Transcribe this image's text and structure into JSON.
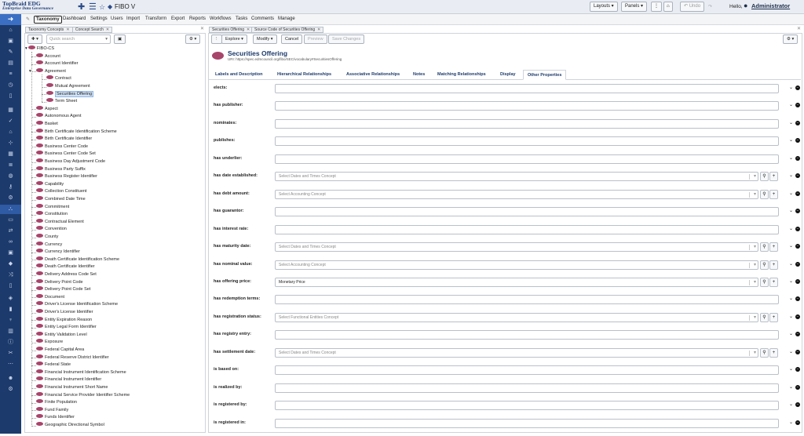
{
  "app": {
    "logo_line1": "TopBraid EDG",
    "logo_line2": "Enterprise Data Governance",
    "title": "FIBO V",
    "undo": "Undo",
    "redo": "",
    "layouts": "Layouts",
    "panels": "Panels",
    "hello": "Hello,",
    "user": "Administrator"
  },
  "menu": [
    "Taxonomy",
    "Dashboard",
    "Settings",
    "Users",
    "Import",
    "Transform",
    "Export",
    "Reports",
    "Workflows",
    "Tasks",
    "Comments",
    "Manage"
  ],
  "left_tabs": [
    "Taxonomy Concepts",
    "Concept Search"
  ],
  "left_toolbar": {
    "search_placeholder": "Quick search"
  },
  "tree": {
    "root": "FIBO-CS",
    "items": [
      {
        "label": "Account",
        "level": 1
      },
      {
        "label": "Account Identifier",
        "level": 1
      },
      {
        "label": "Agreement",
        "level": 1,
        "expanded": true
      },
      {
        "label": "Contract",
        "level": 2
      },
      {
        "label": "Mutual Agreement",
        "level": 2
      },
      {
        "label": "Securities Offering",
        "level": 2,
        "selected": true
      },
      {
        "label": "Term Sheet",
        "level": 2
      },
      {
        "label": "Aspect",
        "level": 1
      },
      {
        "label": "Autonomous Agent",
        "level": 1
      },
      {
        "label": "Basket",
        "level": 1
      },
      {
        "label": "Birth Certificate Identification Scheme",
        "level": 1
      },
      {
        "label": "Birth Certificate Identifier",
        "level": 1
      },
      {
        "label": "Business Center Code",
        "level": 1
      },
      {
        "label": "Business Center Code Set",
        "level": 1
      },
      {
        "label": "Business Day Adjustment Code",
        "level": 1
      },
      {
        "label": "Business Party Suffix",
        "level": 1
      },
      {
        "label": "Business Register Identifier",
        "level": 1
      },
      {
        "label": "Capability",
        "level": 1
      },
      {
        "label": "Collection Constituent",
        "level": 1
      },
      {
        "label": "Combined Date Time",
        "level": 1
      },
      {
        "label": "Commitment",
        "level": 1
      },
      {
        "label": "Constitution",
        "level": 1
      },
      {
        "label": "Contractual Element",
        "level": 1
      },
      {
        "label": "Convention",
        "level": 1
      },
      {
        "label": "County",
        "level": 1
      },
      {
        "label": "Currency",
        "level": 1
      },
      {
        "label": "Currency Identifier",
        "level": 1
      },
      {
        "label": "Death Certificate Identification Scheme",
        "level": 1
      },
      {
        "label": "Death Certificate Identifier",
        "level": 1
      },
      {
        "label": "Delivery Address Code Set",
        "level": 1
      },
      {
        "label": "Delivery Point Code",
        "level": 1
      },
      {
        "label": "Delivery Point Code Set",
        "level": 1
      },
      {
        "label": "Document",
        "level": 1
      },
      {
        "label": "Driver's License Identification Scheme",
        "level": 1
      },
      {
        "label": "Driver's License Identifier",
        "level": 1
      },
      {
        "label": "Entity Expiration Reason",
        "level": 1
      },
      {
        "label": "Entity Legal Form Identifier",
        "level": 1
      },
      {
        "label": "Entity Validation Level",
        "level": 1
      },
      {
        "label": "Exposure",
        "level": 1
      },
      {
        "label": "Federal Capital Area",
        "level": 1
      },
      {
        "label": "Federal Reserve District Identifier",
        "level": 1
      },
      {
        "label": "Federal State",
        "level": 1
      },
      {
        "label": "Financial Instrument Identification Scheme",
        "level": 1
      },
      {
        "label": "Financial Instrument Identifier",
        "level": 1
      },
      {
        "label": "Financial Instrument Short Name",
        "level": 1
      },
      {
        "label": "Financial Service Provider Identifier Scheme",
        "level": 1
      },
      {
        "label": "Finite Population",
        "level": 1
      },
      {
        "label": "Fund Family",
        "level": 1
      },
      {
        "label": "Funds Identifier",
        "level": 1
      },
      {
        "label": "Geographic Directional Symbol",
        "level": 1
      }
    ]
  },
  "right_tabs": [
    "Securities Offering",
    "Source Code of Securities Offering"
  ],
  "right_toolbar": {
    "explore": "Explore",
    "modify": "Modify",
    "cancel": "Cancel",
    "preview": "Preview",
    "save": "Save Changes"
  },
  "resource": {
    "title": "Securities Offering",
    "uri": "URI: https://spec.edmcouncil.org/fibo/SEC/vocabulary#SecuritiesOffering"
  },
  "prop_tabs": [
    "Labels and Description",
    "Hierarchical Relationships",
    "Associative Relationships",
    "Notes",
    "Matching Relationships",
    "Display",
    "Other Properties"
  ],
  "properties": [
    {
      "label": "elects:",
      "type": "text",
      "value": ""
    },
    {
      "label": "has publisher:",
      "type": "text",
      "value": ""
    },
    {
      "label": "nominates:",
      "type": "text",
      "value": ""
    },
    {
      "label": "publishes:",
      "type": "text",
      "value": ""
    },
    {
      "label": "has underlier:",
      "type": "text",
      "value": ""
    },
    {
      "label": "has date established:",
      "type": "select",
      "value": "Select Dates and Times Concept"
    },
    {
      "label": "has debt amount:",
      "type": "select",
      "value": "Select Accounting Concept"
    },
    {
      "label": "has guarantor:",
      "type": "text",
      "value": ""
    },
    {
      "label": "has interest rate:",
      "type": "text",
      "value": ""
    },
    {
      "label": "has maturity date:",
      "type": "select",
      "value": "Select Dates and Times Concept"
    },
    {
      "label": "has nominal value:",
      "type": "select",
      "value": "Select Accounting Concept"
    },
    {
      "label": "has offering price:",
      "type": "select",
      "value": "Monetary Price",
      "filled": true
    },
    {
      "label": "has redemption terms:",
      "type": "text",
      "value": ""
    },
    {
      "label": "has registration status:",
      "type": "select",
      "value": "Select Functional Entities Concept"
    },
    {
      "label": "has registry entry:",
      "type": "text",
      "value": ""
    },
    {
      "label": "has settlement date:",
      "type": "select",
      "value": "Select Dates and Times Concept"
    },
    {
      "label": "is based on:",
      "type": "text",
      "value": ""
    },
    {
      "label": "is realized by:",
      "type": "text",
      "value": ""
    },
    {
      "label": "is registered by:",
      "type": "text",
      "value": ""
    },
    {
      "label": "is registered in:",
      "type": "text",
      "value": ""
    }
  ]
}
